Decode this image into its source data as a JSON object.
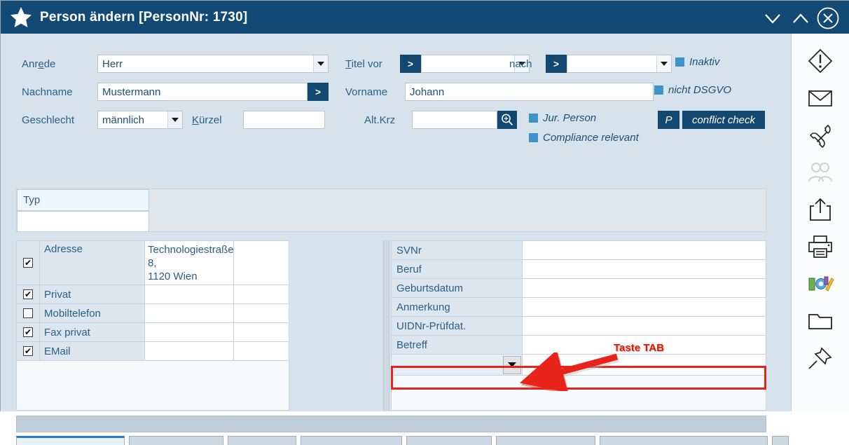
{
  "window": {
    "title": "Person ändern  [PersonNr: 1730]",
    "icon": "star-icon",
    "controls": {
      "minimize": "chevron-down-icon",
      "maximize": "chevron-up-icon",
      "close": "circled-x-icon"
    }
  },
  "form": {
    "anrede": {
      "label_pre": "Anr",
      "label_accel": "e",
      "label_post": "de",
      "value": "Herr"
    },
    "titel_vor": {
      "label_accel": "T",
      "label_post": "itel vor",
      "button": ">",
      "value": ""
    },
    "titel_nach": {
      "label": "nach",
      "button": ">",
      "value": ""
    },
    "inaktiv": {
      "label": "Inaktiv",
      "checked": true
    },
    "nachname": {
      "label": "Nachname",
      "value": "Mustermann",
      "button": ">"
    },
    "vorname": {
      "label": "Vorname",
      "value": "Johann"
    },
    "nicht_dsgvo": {
      "label": "nicht DSGVO",
      "checked": true
    },
    "geschlecht": {
      "label": "Geschlecht",
      "value": "männlich"
    },
    "kuerzel": {
      "label_accel": "K",
      "label_post": "ürzel",
      "value": ""
    },
    "alt_krz": {
      "label": "Alt.Krz",
      "value": "",
      "search_icon": "magnifier-plus-icon"
    },
    "jur_person": {
      "label": "Jur. Person",
      "checked": true
    },
    "compliance_relevant": {
      "label": "Compliance relevant",
      "checked": true
    },
    "p_button": "P",
    "conflict_check_button": "conflict check"
  },
  "typ_panel": {
    "header": "Typ",
    "value": ""
  },
  "left_table": {
    "rows": [
      {
        "label": "Adresse",
        "checked": true,
        "value": "Technologiestraße 8,\n1120 Wien"
      },
      {
        "label": "Privat",
        "checked": true,
        "value": ""
      },
      {
        "label": "Mobiltelefon",
        "checked": false,
        "value": ""
      },
      {
        "label": "Fax privat",
        "checked": true,
        "value": ""
      },
      {
        "label": "EMail",
        "checked": true,
        "value": ""
      }
    ]
  },
  "right_table": {
    "rows": [
      {
        "label": "SVNr",
        "value": ""
      },
      {
        "label": "Beruf",
        "value": ""
      },
      {
        "label": "Geburtsdatum",
        "value": ""
      },
      {
        "label": "Anmerkung",
        "value": ""
      },
      {
        "label": "UIDNr-Prüfdat.",
        "value": ""
      },
      {
        "label": "Betreff",
        "value": ""
      }
    ],
    "dropdown_row": {
      "value": "",
      "highlighted": true
    }
  },
  "annotation": {
    "text": "Taste TAB",
    "color": "#f01400",
    "arrow": "red-arrow-icon"
  },
  "sidebar": {
    "items": [
      {
        "name": "warning-icon"
      },
      {
        "name": "envelope-icon"
      },
      {
        "name": "phone-icon"
      },
      {
        "name": "people-icon"
      },
      {
        "name": "share-export-icon"
      },
      {
        "name": "printer-icon"
      },
      {
        "name": "tools-icon"
      },
      {
        "name": "folder-icon"
      },
      {
        "name": "pin-icon"
      }
    ]
  },
  "bottom_tabs": [
    {
      "active": true
    },
    {
      "active": false
    },
    {
      "active": false
    },
    {
      "active": false
    },
    {
      "active": false
    },
    {
      "active": false
    },
    {
      "active": false
    },
    {
      "active": false
    }
  ],
  "colors": {
    "titlebar": "#134a75",
    "background": "#d7e3ec",
    "accent": "#3f93c8",
    "label_text": "#2b5f86",
    "dark_button": "#12486f",
    "annotation_red": "#f01400",
    "highlight_border": "#e8231a"
  }
}
